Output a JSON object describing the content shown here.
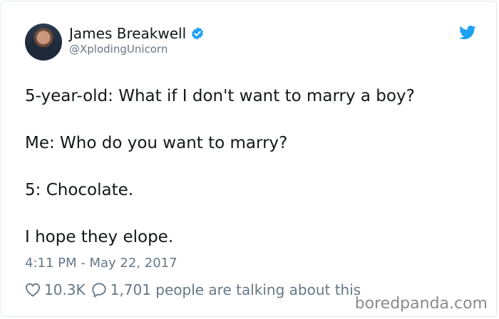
{
  "author": {
    "display_name": "James Breakwell",
    "handle": "@XplodingUnicorn",
    "verified": true
  },
  "tweet": {
    "lines": [
      "5-year-old: What if I don't want to marry a boy?",
      "Me: Who do you want to marry?",
      "5: Chocolate.",
      "I hope they elope."
    ],
    "timestamp": "4:11 PM - May 22, 2017",
    "like_count": "10.3K",
    "talking_text": "1,701 people are talking about this"
  },
  "watermark": "boredpanda.com",
  "icons": {
    "brand": "twitter-bird-icon",
    "verified": "verified-badge-icon",
    "like": "heart-icon",
    "reply": "speech-bubble-icon"
  },
  "colors": {
    "twitter_blue": "#1da1f2",
    "text_primary": "#14171a",
    "text_secondary": "#657786"
  }
}
